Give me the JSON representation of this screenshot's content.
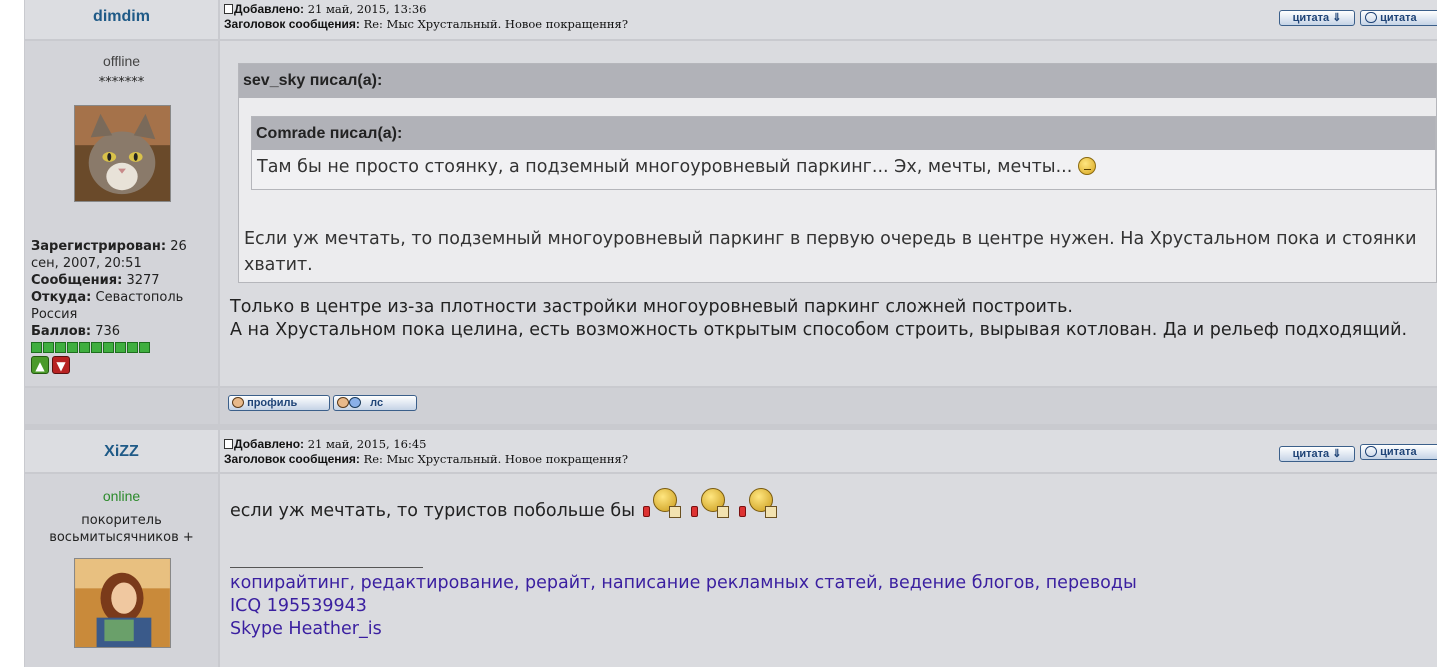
{
  "posts": [
    {
      "username": "dimdim",
      "status": "offline",
      "rank": "*******",
      "registered_label": "Зарегистрирован:",
      "registered_value": "26 сен, 2007, 20:51",
      "messages_label": "Сообщения:",
      "messages_value": "3277",
      "from_label": "Откуда:",
      "from_value": "Севастополь Россия",
      "points_label": "Баллов:",
      "points_value": "736",
      "added_label": "Добавлено:",
      "added_value": "21 май, 2015, 13:36",
      "subject_label": "Заголовок сообщения:",
      "subject_value": "Re: Мыс Хрустальный. Новое покращення?",
      "quote_btn": "цитата",
      "quote_btn2": "цитата",
      "outer_quote_author": "sev_sky писал(а):",
      "inner_quote_author": "Comrade писал(а):",
      "inner_quote_text": "Там бы не просто стоянку, а подземный многоуровневый паркинг... Эх, мечты, мечты...",
      "outer_quote_text": "Если уж мечтать, то подземный многоуровневый паркинг в первую очередь в центре нужен. На Хрустальном пока и стоянки хватит.",
      "body_line1": "Только в центре из-за плотности застройки многоуровневый паркинг сложней построить.",
      "body_line2": "А на Хрустальном пока целина, есть возможность открытым способом строить, вырывая котлован. Да и рельеф подходящий.",
      "profile_btn": "профиль",
      "pm_btn": "лс"
    },
    {
      "username": "XiZZ",
      "status": "online",
      "rank": "покоритель восьмитысячников +",
      "added_label": "Добавлено:",
      "added_value": "21 май, 2015, 16:45",
      "subject_label": "Заголовок сообщения:",
      "subject_value": "Re: Мыс Хрустальный. Новое покращення?",
      "quote_btn": "цитата",
      "quote_btn2": "цитата",
      "body_text": "если уж мечтать, то туристов побольше бы",
      "sig_line1": "копирайтинг, редактирование, рерайт, написание рекламных статей, ведение блогов, переводы",
      "sig_line2": "ICQ 195539943",
      "sig_line3": "Skype Heather_is"
    }
  ],
  "colors": {
    "username": "#1f5a87",
    "online": "#2b8a2b",
    "signature": "#3a1fa0",
    "reputation_bar": "#3fae3f"
  },
  "reputation_level": 10
}
